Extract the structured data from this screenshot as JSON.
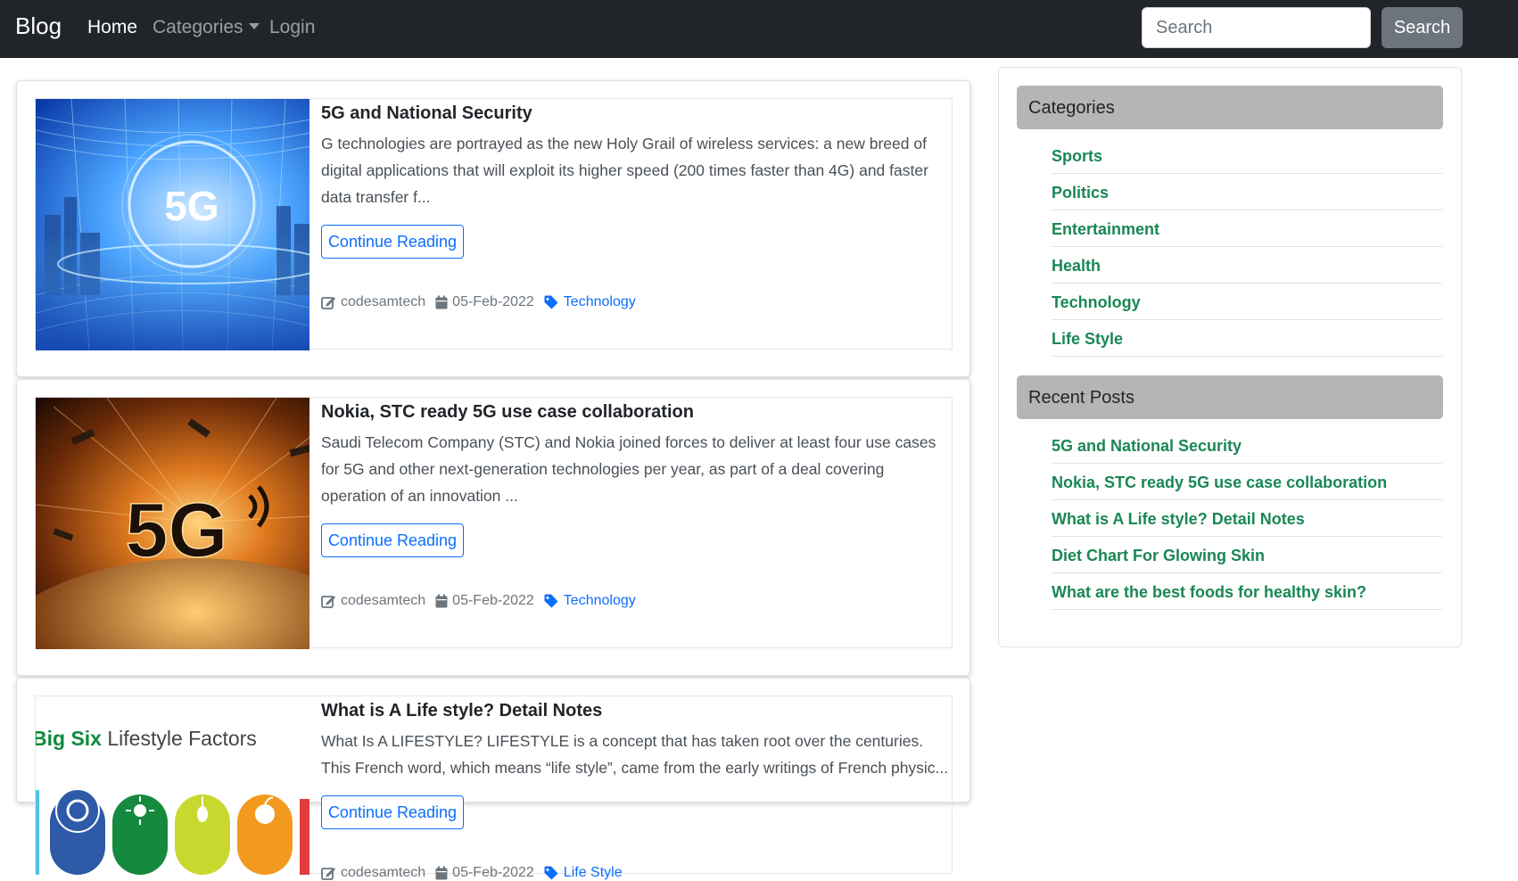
{
  "navbar": {
    "brand": "Blog",
    "links": {
      "home": "Home",
      "categories": "Categories",
      "login": "Login"
    },
    "search": {
      "placeholder": "Search",
      "button_label": "Search"
    }
  },
  "posts": [
    {
      "title": "5G and National Security",
      "excerpt": "G technologies are portrayed as the new Holy Grail of wireless services: a new breed of digital applications that will exploit its higher speed (200 times faster than 4G) and faster data transfer f...",
      "button_label": "Continue Reading",
      "author": "codesamtech",
      "date": "05-Feb-2022",
      "category": "Technology",
      "image_text": "5G"
    },
    {
      "title": "Nokia, STC ready 5G use case collaboration",
      "excerpt": "Saudi Telecom Company (STC) and Nokia joined forces to deliver at least four use cases for 5G and other next-generation technologies per year, as part of a deal covering operation of an innovation ...",
      "button_label": "Continue Reading",
      "author": "codesamtech",
      "date": "05-Feb-2022",
      "category": "Technology",
      "image_text": "5G"
    },
    {
      "title": "What is A Life style? Detail Notes",
      "excerpt": "What Is A LIFESTYLE? LIFESTYLE is a concept that has taken root over the centuries. This French word, which means “life style”, came from the early writings of French physic...",
      "button_label": "Continue Reading",
      "author": "codesamtech",
      "date": "05-Feb-2022",
      "category": "Life Style",
      "image_text": {
        "bold": "Big Six",
        "rest": " Lifestyle Factors"
      }
    }
  ],
  "sidebar": {
    "categories_heading": "Categories",
    "categories": [
      "Sports",
      "Politics",
      "Entertainment",
      "Health",
      "Technology",
      "Life Style"
    ],
    "recent_heading": "Recent Posts",
    "recent_posts": [
      "5G and National Security",
      "Nokia, STC ready 5G use case collaboration",
      "What is A Life style? Detail Notes",
      "Diet Chart For Glowing Skin",
      "What are the best foods for healthy skin?"
    ]
  },
  "colors": {
    "navbar_bg": "#212529",
    "link_blue": "#0d6efd",
    "sidebar_link_green": "#198754",
    "sidebar_heading_bg": "#b5b5b5",
    "lifestyle_green": "#0f8a3c",
    "lifestyle_circles": [
      "#2e5aa8",
      "#158a3e",
      "#c9d82f",
      "#f39a1e"
    ]
  },
  "icons": {
    "author": "pen-square-icon",
    "date": "calendar-icon",
    "category": "tag-icon"
  }
}
